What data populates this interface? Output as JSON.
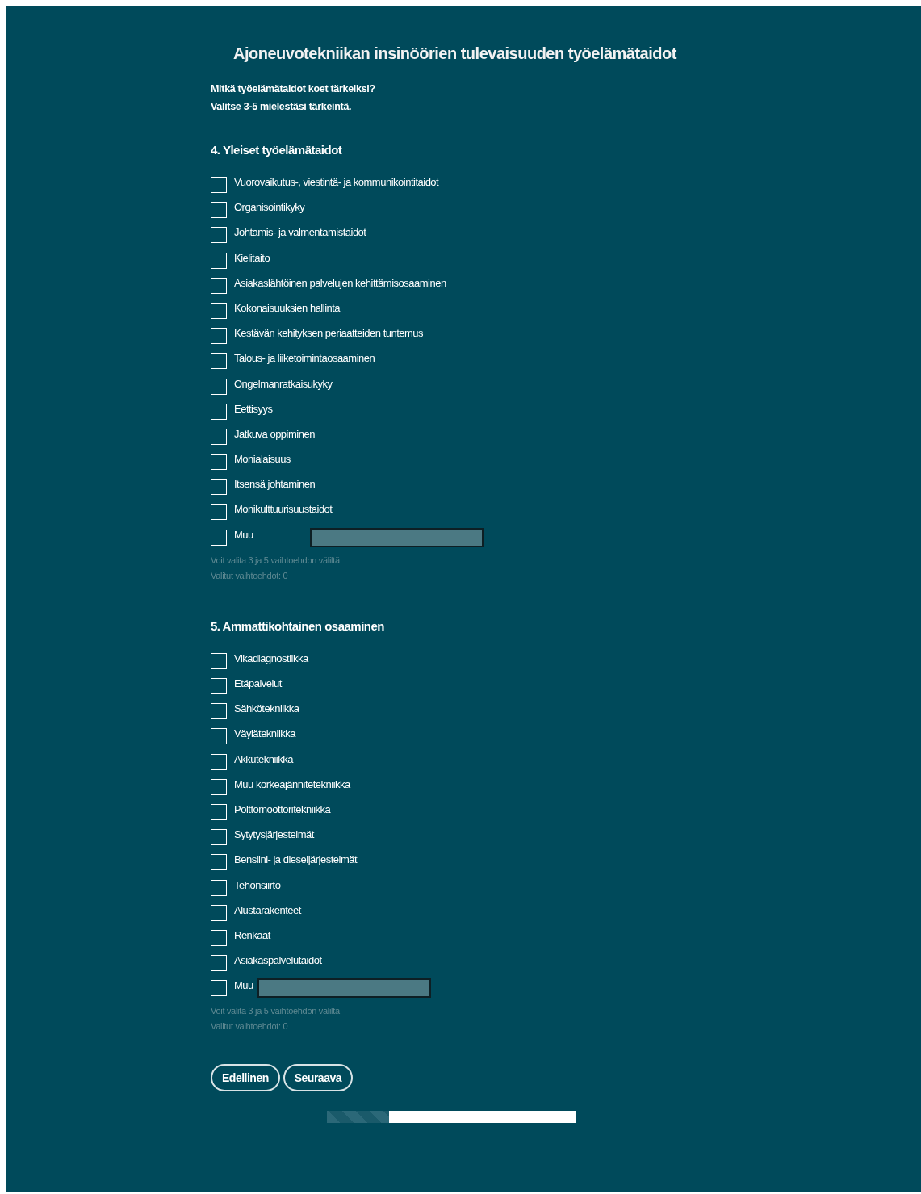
{
  "title": "Ajoneuvotekniikan insinöörien tulevaisuuden työelämätaidot",
  "intro": [
    "Mitkä työelämätaidot koet tärkeiksi?",
    "Valitse 3-5 mielestäsi tärkeintä."
  ],
  "sections": [
    {
      "heading": "4. Yleiset työelämätaidot",
      "options": [
        {
          "label": "Vuorovaikutus-, viestintä- ja kommunikointitaidot",
          "checked": false
        },
        {
          "label": "Organisointikyky",
          "checked": false
        },
        {
          "label": "Johtamis- ja valmentamistaidot",
          "checked": false
        },
        {
          "label": "Kielitaito",
          "checked": false
        },
        {
          "label": "Asiakaslähtöinen palvelujen kehittämisosaaminen",
          "checked": false
        },
        {
          "label": "Kokonaisuuksien hallinta",
          "checked": false
        },
        {
          "label": "Kestävän kehityksen periaatteiden tuntemus",
          "checked": false
        },
        {
          "label": "Talous- ja liiketoimintaosaaminen",
          "checked": false
        },
        {
          "label": "Ongelmanratkaisukyky",
          "checked": false
        },
        {
          "label": "Eettisyys",
          "checked": false
        },
        {
          "label": "Jatkuva oppiminen",
          "checked": false
        },
        {
          "label": "Monialaisuus",
          "checked": false
        },
        {
          "label": "Itsensä johtaminen",
          "checked": false
        },
        {
          "label": "Monikulttuurisuustaidot",
          "checked": false
        }
      ],
      "other": {
        "label": "Muu",
        "checked": false
      },
      "hint": "Voit valita 3 ja 5 vaihtoehdon väliltä",
      "count": "Valitut vaihtoehdot: 0"
    },
    {
      "heading": "5. Ammattikohtainen osaaminen",
      "options": [
        {
          "label": "Vikadiagnostiikka",
          "checked": false
        },
        {
          "label": "Etäpalvelut",
          "checked": false
        },
        {
          "label": "Sähkötekniikka",
          "checked": false
        },
        {
          "label": "Väylätekniikka",
          "checked": false
        },
        {
          "label": "Akkutekniikka",
          "checked": false
        },
        {
          "label": "Muu korkeajännitetekniikka",
          "checked": false
        },
        {
          "label": "Polttomoottoritekniikka",
          "checked": false
        },
        {
          "label": "Sytytysjärjestelmät",
          "checked": false
        },
        {
          "label": "Bensiini- ja dieseljärjestelmät",
          "checked": false
        },
        {
          "label": "Tehonsiirto",
          "checked": false
        },
        {
          "label": "Alustarakenteet",
          "checked": false
        },
        {
          "label": "Renkaat",
          "checked": false
        },
        {
          "label": "Asiakaspalvelutaidot",
          "checked": false
        }
      ],
      "other": {
        "label": "Muu",
        "checked": false
      },
      "hint": "Voit valita 3 ja 5 vaihtoehdon väliltä",
      "count": "Valitut vaihtoehdot: 0"
    }
  ],
  "buttons": [
    "Edellinen",
    "Seuraava"
  ],
  "progress": {
    "level": 0.25
  }
}
